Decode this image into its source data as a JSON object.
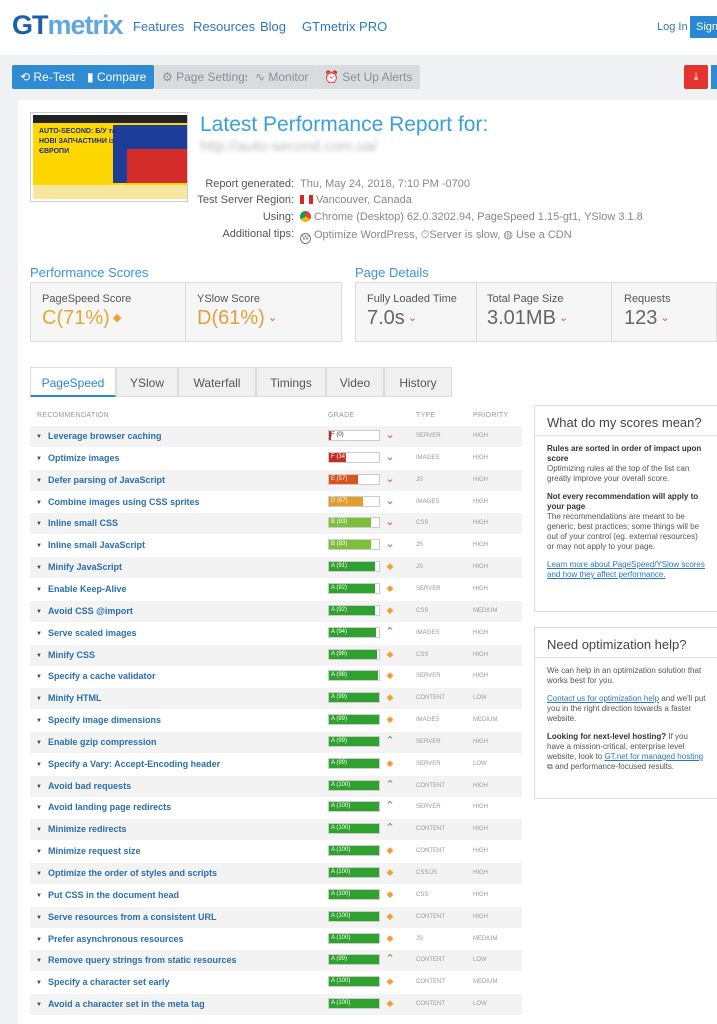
{
  "nav": {
    "logo_gt": "GT",
    "logo_metrix": "metrix",
    "links": [
      "Features",
      "Resources",
      "Blog",
      "GTmetrix PRO"
    ],
    "login": "Log In",
    "signup": "Sign"
  },
  "toolbar": {
    "retest": "Re-Test",
    "compare": "Compare",
    "page_settings": "Page Settings",
    "monitor": "Monitor",
    "alerts": "Set Up Alerts"
  },
  "thumb": {
    "headline": "AUTO-SECOND: Б/У та НОВІ ЗАПЧАСТИНИ із ЄВРОПИ"
  },
  "report": {
    "title": "Latest Performance Report for:",
    "url": "http://auto-second.com.ua/",
    "generated_label": "Report generated:",
    "generated_value": "Thu, May 24, 2018, 7:10 PM -0700",
    "region_label": "Test Server Region:",
    "region_value": "Vancouver, Canada",
    "using_label": "Using:",
    "using_value": "Chrome (Desktop) 62.0.3202.94, PageSpeed 1.15-gt1, YSlow 3.1.8",
    "tips_label": "Additional tips:",
    "tip1": "Optimize WordPress,",
    "tip2": "Server is slow,",
    "tip3": "Use a CDN"
  },
  "scores": {
    "title": "Performance Scores",
    "pagespeed_label": "PageSpeed Score",
    "pagespeed_grade": "C",
    "pagespeed_value": "(71%)",
    "yslow_label": "YSlow Score",
    "yslow_grade": "D",
    "yslow_value": "(61%)"
  },
  "details": {
    "title": "Page Details",
    "loaded_label": "Fully Loaded Time",
    "loaded_value": "7.0s",
    "size_label": "Total Page Size",
    "size_value": "3.01MB",
    "requests_label": "Requests",
    "requests_value": "123"
  },
  "tabs": [
    "PageSpeed",
    "YSlow",
    "Waterfall",
    "Timings",
    "Video",
    "History"
  ],
  "table_headers": {
    "recommendation": "RECOMMENDATION",
    "grade": "GRADE",
    "type": "TYPE",
    "priority": "PRIORITY"
  },
  "colors": {
    "grade_a": "#2ea12e",
    "grade_b": "#7cbf3b",
    "grade_d": "#e39b2a",
    "grade_e": "#d9541e",
    "grade_f": "#c62a24",
    "down_red": "#e84b4b",
    "diamond_orange": "#f0a030",
    "up_green": "#3aa53a"
  },
  "recommendations": [
    {
      "name": "Leverage browser caching",
      "grade": "F (0)",
      "score": 0,
      "ind": "down",
      "type": "SERVER",
      "priority": "HIGH"
    },
    {
      "name": "Optimize images",
      "grade": "F (34)",
      "score": 34,
      "ind": "down",
      "type": "IMAGES",
      "priority": "HIGH"
    },
    {
      "name": "Defer parsing of JavaScript",
      "grade": "E (57)",
      "score": 57,
      "ind": "down",
      "type": "JS",
      "priority": "HIGH"
    },
    {
      "name": "Combine images using CSS sprites",
      "grade": "D (67)",
      "score": 67,
      "ind": "down",
      "type": "IMAGES",
      "priority": "HIGH"
    },
    {
      "name": "Inline small CSS",
      "grade": "B (83)",
      "score": 83,
      "ind": "down",
      "type": "CSS",
      "priority": "HIGH"
    },
    {
      "name": "Inline small JavaScript",
      "grade": "B (83)",
      "score": 83,
      "ind": "down",
      "type": "JS",
      "priority": "HIGH"
    },
    {
      "name": "Minify JavaScript",
      "grade": "A (91)",
      "score": 91,
      "ind": "diamond",
      "type": "JS",
      "priority": "HIGH"
    },
    {
      "name": "Enable Keep-Alive",
      "grade": "A (92)",
      "score": 92,
      "ind": "diamond",
      "type": "SERVER",
      "priority": "HIGH"
    },
    {
      "name": "Avoid CSS @import",
      "grade": "A (92)",
      "score": 92,
      "ind": "diamond",
      "type": "CSS",
      "priority": "MEDIUM"
    },
    {
      "name": "Serve scaled images",
      "grade": "A (94)",
      "score": 94,
      "ind": "up",
      "type": "IMAGES",
      "priority": "HIGH"
    },
    {
      "name": "Minify CSS",
      "grade": "A (96)",
      "score": 96,
      "ind": "diamond",
      "type": "CSS",
      "priority": "HIGH"
    },
    {
      "name": "Specify a cache validator",
      "grade": "A (98)",
      "score": 98,
      "ind": "diamond",
      "type": "SERVER",
      "priority": "HIGH"
    },
    {
      "name": "Minify HTML",
      "grade": "A (99)",
      "score": 99,
      "ind": "diamond",
      "type": "CONTENT",
      "priority": "LOW"
    },
    {
      "name": "Specify image dimensions",
      "grade": "A (99)",
      "score": 99,
      "ind": "diamond",
      "type": "IMAGES",
      "priority": "MEDIUM"
    },
    {
      "name": "Enable gzip compression",
      "grade": "A (99)",
      "score": 99,
      "ind": "up",
      "type": "SERVER",
      "priority": "HIGH"
    },
    {
      "name": "Specify a Vary: Accept-Encoding header",
      "grade": "A (99)",
      "score": 99,
      "ind": "diamond",
      "type": "SERVER",
      "priority": "LOW"
    },
    {
      "name": "Avoid bad requests",
      "grade": "A (100)",
      "score": 100,
      "ind": "up",
      "type": "CONTENT",
      "priority": "HIGH"
    },
    {
      "name": "Avoid landing page redirects",
      "grade": "A (100)",
      "score": 100,
      "ind": "up",
      "type": "SERVER",
      "priority": "HIGH"
    },
    {
      "name": "Minimize redirects",
      "grade": "A (100)",
      "score": 100,
      "ind": "up",
      "type": "CONTENT",
      "priority": "HIGH"
    },
    {
      "name": "Minimize request size",
      "grade": "A (100)",
      "score": 100,
      "ind": "diamond",
      "type": "CONTENT",
      "priority": "HIGH"
    },
    {
      "name": "Optimize the order of styles and scripts",
      "grade": "A (100)",
      "score": 100,
      "ind": "diamond",
      "type": "CSS/JS",
      "priority": "HIGH"
    },
    {
      "name": "Put CSS in the document head",
      "grade": "A (100)",
      "score": 100,
      "ind": "diamond",
      "type": "CSS",
      "priority": "HIGH"
    },
    {
      "name": "Serve resources from a consistent URL",
      "grade": "A (100)",
      "score": 100,
      "ind": "diamond",
      "type": "CONTENT",
      "priority": "HIGH"
    },
    {
      "name": "Prefer asynchronous resources",
      "grade": "A (100)",
      "score": 100,
      "ind": "diamond",
      "type": "JS",
      "priority": "MEDIUM"
    },
    {
      "name": "Remove query strings from static resources",
      "grade": "A (99)",
      "score": 99,
      "ind": "up",
      "type": "CONTENT",
      "priority": "LOW"
    },
    {
      "name": "Specify a character set early",
      "grade": "A (100)",
      "score": 100,
      "ind": "diamond",
      "type": "CONTENT",
      "priority": "MEDIUM"
    },
    {
      "name": "Avoid a character set in the meta tag",
      "grade": "A (100)",
      "score": 100,
      "ind": "diamond",
      "type": "CONTENT",
      "priority": "LOW"
    }
  ],
  "side1": {
    "title": "What do my scores mean?",
    "h1": "Rules are sorted in order of impact upon score",
    "p1": "Optimizing rules at the top of the list can greatly improve your overall score.",
    "h2": "Not every recommendation will apply to your page",
    "p2": "The recommendations are meant to be generic, best practices; some things will be out of your control (eg. external resources) or may not apply to your page.",
    "link": "Learn more about PageSpeed/YSlow scores and how they affect performance."
  },
  "side2": {
    "title": "Need optimization help?",
    "p1": "We can help in an optimization solution that works best for you.",
    "contact_link": "Contact us for optimization help",
    "p2": "and we'll put you in the right direction towards a faster website.",
    "h": "Looking for next-level hosting?",
    "p3": "If you have a mission-critical, enterprise level website, look to",
    "gt_link": "GT.net for managed hosting",
    "p4": "and performance-focused results."
  }
}
